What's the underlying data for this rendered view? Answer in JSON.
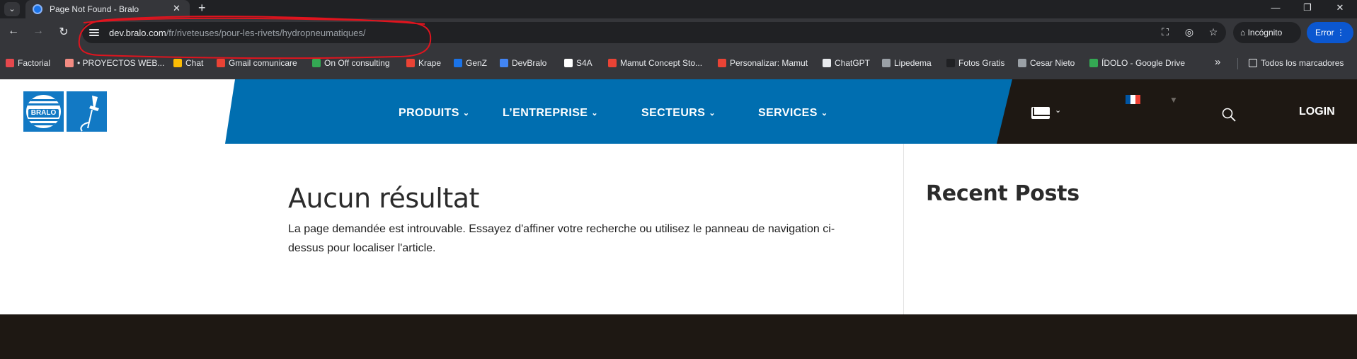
{
  "browser": {
    "tab_title": "Page Not Found - Bralo",
    "new_tab_symbol": "+",
    "url_host": "dev.bralo.com",
    "url_path": "/fr/riveteuses/pour-les-rivets/hydropneumatiques/",
    "incognito_label": "Incógnito",
    "error_label": "Error",
    "bookmarks": [
      {
        "label": "Factorial",
        "color": "#e5484d"
      },
      {
        "label": "• PROYECTOS WEB...",
        "color": "#f28b82"
      },
      {
        "label": "Chat",
        "color": "#fbbc04"
      },
      {
        "label": "Gmail comunicare",
        "color": "#ea4335"
      },
      {
        "label": "On Off consulting",
        "color": "#34a853"
      },
      {
        "label": "Krape",
        "color": "#ea4335"
      },
      {
        "label": "GenZ",
        "color": "#1a73e8"
      },
      {
        "label": "DevBralo",
        "color": "#4285f4"
      },
      {
        "label": "S4A",
        "color": "#ffffff"
      },
      {
        "label": "Mamut Concept Sto...",
        "color": "#ea4335"
      },
      {
        "label": "Personalizar: Mamut",
        "color": "#ea4335"
      },
      {
        "label": "ChatGPT",
        "color": "#e8eaed"
      },
      {
        "label": "Lipedema",
        "color": "#9aa0a6"
      },
      {
        "label": "Fotos Gratis",
        "color": "#202124"
      },
      {
        "label": "Cesar Nieto",
        "color": "#9aa0a6"
      },
      {
        "label": "ÍDOLO - Google Drive",
        "color": "#34a853"
      }
    ],
    "all_bookmarks_label": "Todos los marcadores",
    "more_bookmarks_symbol": "»"
  },
  "site": {
    "logo_text": "BRALO",
    "nav": [
      {
        "label": "PRODUITS",
        "chevron": "⌄"
      },
      {
        "label": "L’ENTREPRISE",
        "chevron": "⌄"
      },
      {
        "label": "SECTEURS",
        "chevron": "⌄"
      },
      {
        "label": "SERVICES",
        "chevron": "⌄"
      }
    ],
    "login_label": "LOGIN",
    "mail_chevron": "⌄",
    "flag_colors": [
      "#0055a4",
      "#ffffff",
      "#ef4135"
    ],
    "caret": "▼"
  },
  "content": {
    "title": "Aucun résultat",
    "message": "La page demandée est introuvable. Essayez d'affiner votre recherche ou utilisez le panneau de navigation ci-dessus pour localiser l'article."
  },
  "sidebar": {
    "title": "Recent Posts"
  },
  "colors": {
    "brand_blue": "#006eb0",
    "brand_dark": "#1e1813",
    "annotation_red": "#e0141e"
  }
}
